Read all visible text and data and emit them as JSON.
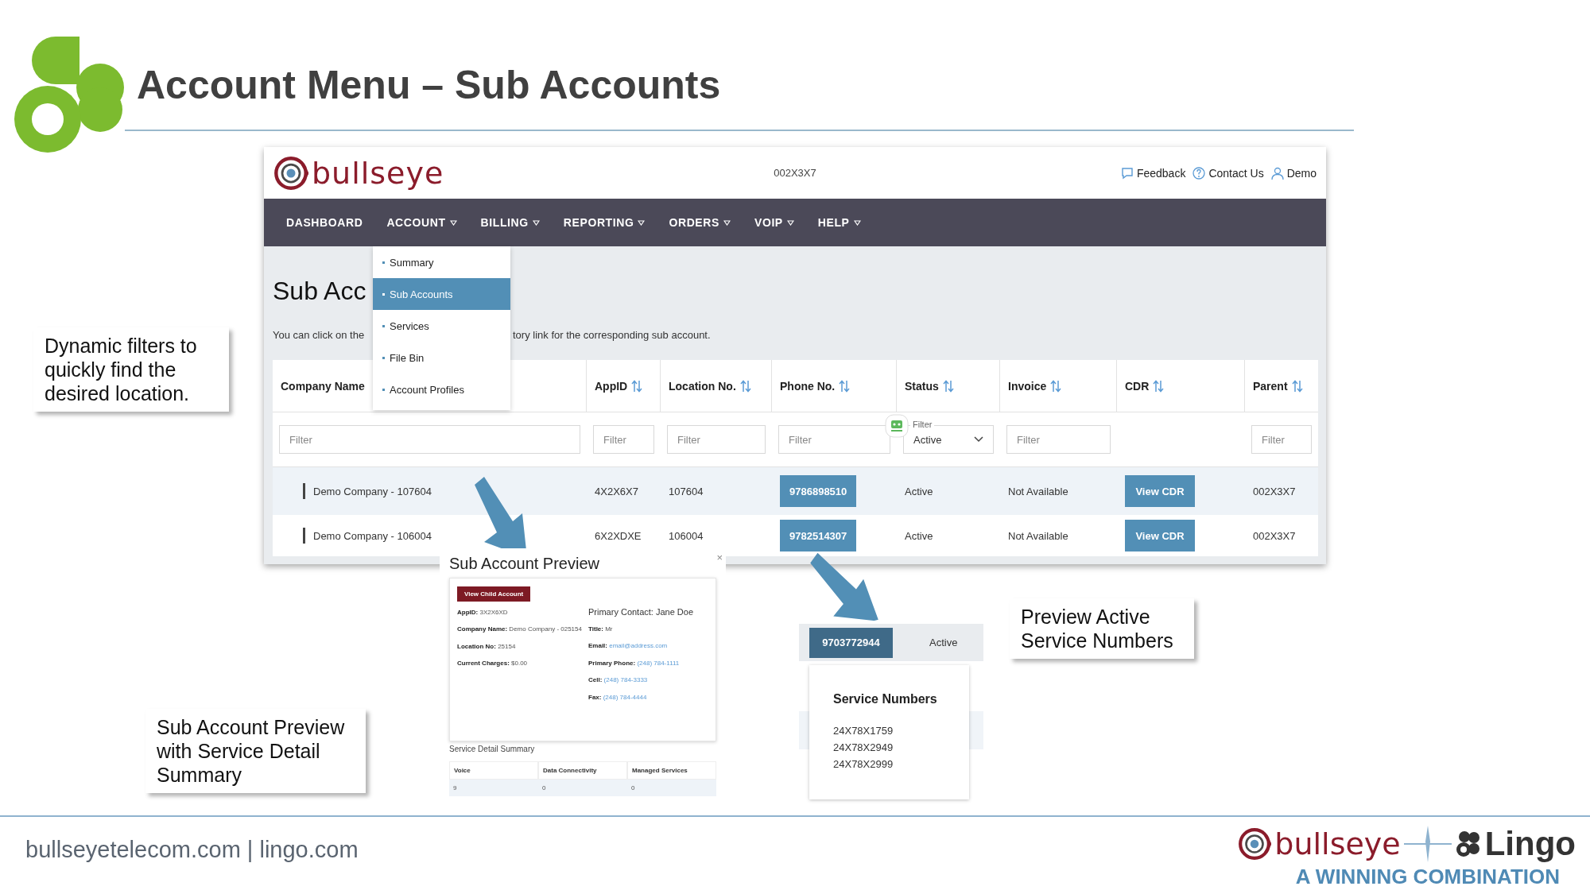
{
  "slide": {
    "title": "Account Menu – Sub Accounts",
    "footer_text": "bullseyetelecom.com | lingo.com",
    "footer_logo": {
      "brand_1": "bullseye",
      "brand_2": "Lingo",
      "tagline": "A WINNING COMBINATION"
    }
  },
  "app": {
    "logo_text": "bullseye",
    "account_id": "002X3X7",
    "header_links": [
      {
        "label": "Feedback"
      },
      {
        "label": "Contact Us"
      },
      {
        "label": "Demo"
      }
    ],
    "nav": [
      {
        "label": "DASHBOARD",
        "dropdown": false
      },
      {
        "label": "ACCOUNT",
        "dropdown": true
      },
      {
        "label": "BILLING",
        "dropdown": true
      },
      {
        "label": "REPORTING",
        "dropdown": true
      },
      {
        "label": "ORDERS",
        "dropdown": true
      },
      {
        "label": "VOIP",
        "dropdown": true
      },
      {
        "label": "HELP",
        "dropdown": true
      }
    ],
    "menu": [
      {
        "label": "Summary",
        "selected": false
      },
      {
        "label": "Sub Accounts",
        "selected": true
      },
      {
        "label": "Services",
        "selected": false
      },
      {
        "label": "File Bin",
        "selected": false
      },
      {
        "label": "Account Profiles",
        "selected": false
      }
    ],
    "page_title": "Sub Acc",
    "description": [
      "You can click on the",
      "tory link for the corresponding sub account."
    ],
    "table": {
      "columns": [
        {
          "label": "Company Name",
          "sortable": false,
          "filter": {
            "kind": "text",
            "placeholder": "Filter"
          }
        },
        {
          "label": "AppID",
          "sortable": true,
          "filter": {
            "kind": "text",
            "placeholder": "Filter"
          }
        },
        {
          "label": "Location No.",
          "sortable": true,
          "filter": {
            "kind": "text",
            "placeholder": "Filter"
          }
        },
        {
          "label": "Phone No.",
          "sortable": true,
          "filter": {
            "kind": "text",
            "placeholder": "Filter"
          }
        },
        {
          "label": "Status",
          "sortable": true,
          "filter": {
            "kind": "select",
            "label": "Filter",
            "value": "Active"
          }
        },
        {
          "label": "Invoice",
          "sortable": true,
          "filter": {
            "kind": "text",
            "placeholder": "Filter"
          }
        },
        {
          "label": "CDR",
          "sortable": true
        },
        {
          "label": "Parent",
          "sortable": true,
          "filter": {
            "kind": "text",
            "placeholder": "Filter"
          }
        }
      ],
      "rows": [
        {
          "company": "Demo Company - 107604",
          "app_id": "4X2X6X7",
          "location": "107604",
          "phone": "9786898510",
          "status": "Active",
          "invoice": "Not Available",
          "cdr": "View CDR",
          "parent": "002X3X7"
        },
        {
          "company": "Demo Company - 106004",
          "app_id": "6X2XDXE",
          "location": "106004",
          "phone": "9782514307",
          "status": "Active",
          "invoice": "Not Available",
          "cdr": "View CDR",
          "parent": "002X3X7"
        }
      ]
    }
  },
  "callouts": [
    {
      "text": "Dynamic filters to quickly find the desired location."
    },
    {
      "text": "Sub Account Preview with Service Detail Summary"
    },
    {
      "text": "Preview Active Service Numbers"
    }
  ],
  "preview": {
    "title": "Sub Account Preview",
    "close": "×",
    "button": "View Child Account",
    "left_fields": [
      {
        "label": "AppID:",
        "value": "3X2X6XD",
        "kind": "plain"
      },
      {
        "label": "Company Name:",
        "value": "Demo Company - 025154",
        "kind": "plain"
      },
      {
        "label": "Location No:",
        "value": "25154",
        "kind": "plain"
      },
      {
        "label": "Current Charges:",
        "value": "$0.00",
        "kind": "plain"
      }
    ],
    "contact_heading": "Primary Contact: Jane Doe",
    "right_fields": [
      {
        "label": "Title:",
        "value": "Mr",
        "kind": "plain"
      },
      {
        "label": "Email:",
        "value": "email@address.com",
        "kind": "link"
      },
      {
        "label": "Primary Phone:",
        "value": "(248) 784-1111",
        "kind": "link"
      },
      {
        "label": "Cell:",
        "value": "(248) 784-3333",
        "kind": "link"
      },
      {
        "label": "Fax:",
        "value": "(248) 784-4444",
        "kind": "link"
      }
    ],
    "summary_title": "Service Detail Summary",
    "summary_columns": [
      "Voice",
      "Data Connectivity",
      "Managed Services"
    ],
    "summary_values": [
      "9",
      "0",
      "0"
    ]
  },
  "service_numbers": {
    "phone": "9703772944",
    "hovered": true,
    "status": "Active",
    "title": "Service Numbers",
    "numbers": [
      "24X78X1759",
      "24X78X2949",
      "24X78X2999"
    ]
  }
}
